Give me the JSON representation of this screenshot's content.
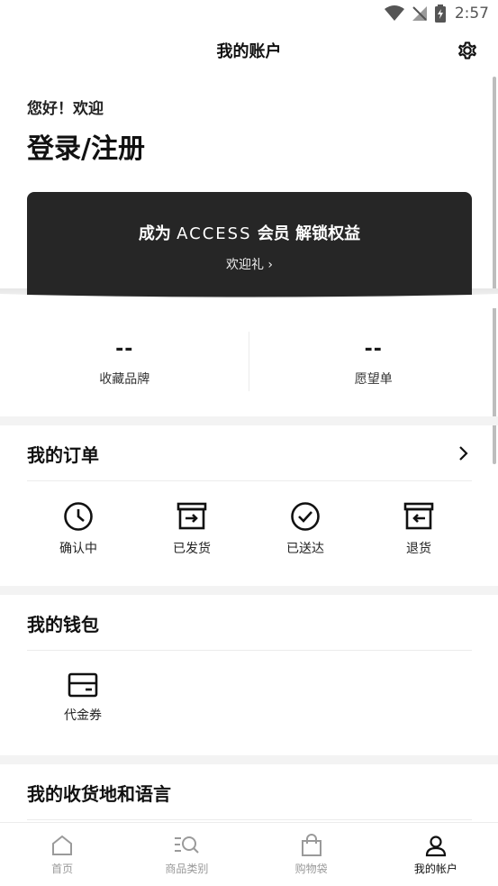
{
  "status_bar": {
    "time": "2:57"
  },
  "header": {
    "title": "我的账户"
  },
  "profile": {
    "greeting": "您好！欢迎",
    "login_label": "登录/注册"
  },
  "member_card": {
    "prefix": "成为",
    "brand": "ACCESS",
    "suffix": "会员 解锁权益",
    "link": "欢迎礼 ›"
  },
  "stats": [
    {
      "value": "--",
      "label": "收藏品牌"
    },
    {
      "value": "--",
      "label": "愿望单"
    }
  ],
  "orders": {
    "title": "我的订单",
    "items": [
      {
        "label": "确认中",
        "icon": "clock-icon"
      },
      {
        "label": "已发货",
        "icon": "box-out-icon"
      },
      {
        "label": "已送达",
        "icon": "check-circle-icon"
      },
      {
        "label": "退货",
        "icon": "box-return-icon"
      }
    ]
  },
  "wallet": {
    "title": "我的钱包",
    "items": [
      {
        "label": "代金券",
        "icon": "voucher-icon"
      }
    ]
  },
  "address_language": {
    "title": "我的收货地和语言"
  },
  "tabbar": {
    "items": [
      {
        "label": "首页",
        "icon": "home-icon",
        "active": false
      },
      {
        "label": "商品类别",
        "icon": "category-search-icon",
        "active": false
      },
      {
        "label": "购物袋",
        "icon": "shopping-bag-icon",
        "active": false
      },
      {
        "label": "我的帐户",
        "icon": "user-icon",
        "active": true
      }
    ]
  }
}
